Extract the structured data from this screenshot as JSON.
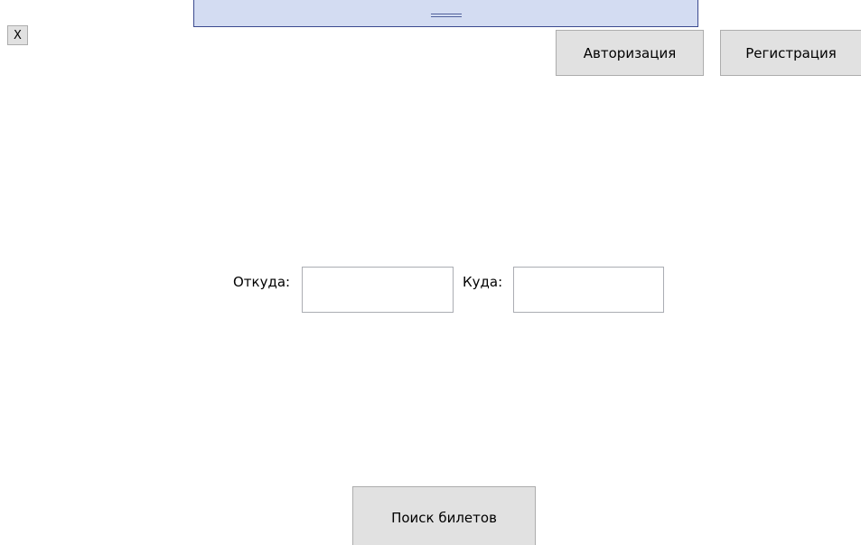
{
  "window": {
    "close_label": "X"
  },
  "header": {
    "auth_label": "Авторизация",
    "register_label": "Регистрация"
  },
  "search_form": {
    "from_label": "Откуда:",
    "from_value": "",
    "to_label": "Куда:",
    "to_value": "",
    "search_label": "Поиск билетов"
  },
  "colors": {
    "panel_fill": "#d3dcf2",
    "panel_border": "#3b4a8f",
    "button_fill": "#e1e1e1"
  }
}
